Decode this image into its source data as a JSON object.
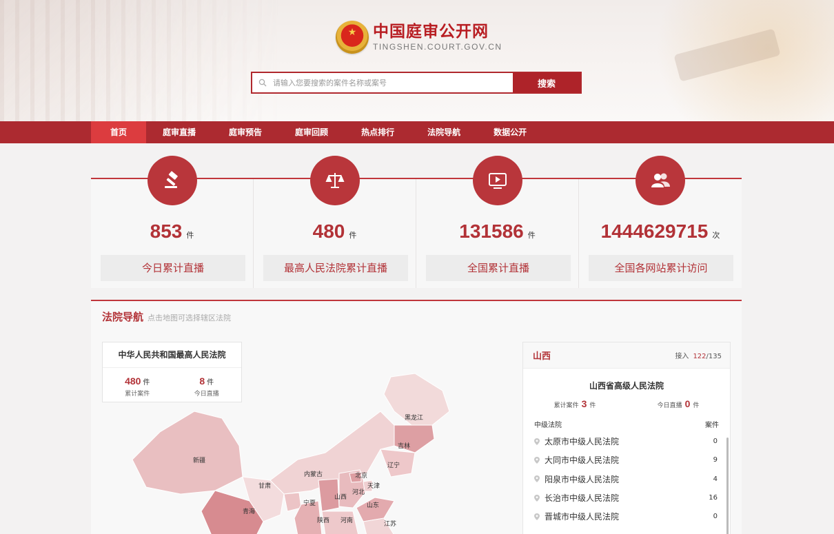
{
  "header": {
    "title": "中国庭审公开网",
    "subtitle": "TINGSHEN.COURT.GOV.CN",
    "search_placeholder": "请输入您要搜索的案件名称或案号",
    "search_button": "搜索"
  },
  "nav": {
    "items": [
      {
        "label": "首页"
      },
      {
        "label": "庭审直播"
      },
      {
        "label": "庭审预告"
      },
      {
        "label": "庭审回顾"
      },
      {
        "label": "热点排行"
      },
      {
        "label": "法院导航"
      },
      {
        "label": "数据公开"
      }
    ]
  },
  "stats": [
    {
      "icon": "gavel-icon",
      "value": "853",
      "unit": "件",
      "label": "今日累计直播"
    },
    {
      "icon": "scales-icon",
      "value": "480",
      "unit": "件",
      "label": "最高人民法院累计直播"
    },
    {
      "icon": "play-icon",
      "value": "131586",
      "unit": "件",
      "label": "全国累计直播"
    },
    {
      "icon": "users-icon",
      "value": "1444629715",
      "unit": "次",
      "label": "全国各网站累计访问"
    }
  ],
  "court_nav": {
    "title": "法院导航",
    "hint": "点击地图可选择辖区法院",
    "supreme": {
      "name": "中华人民共和国最高人民法院",
      "total_value": "480",
      "total_unit": "件",
      "total_label": "累计案件",
      "today_value": "8",
      "today_unit": "件",
      "today_label": "今日直播"
    },
    "map_labels": [
      "黑龙江",
      "吉林",
      "辽宁",
      "新疆",
      "内蒙古",
      "北京",
      "天津",
      "甘肃",
      "河北",
      "宁夏",
      "山西",
      "山东",
      "青海",
      "陕西",
      "河南",
      "江苏"
    ],
    "province": {
      "name": "山西",
      "connected_label": "接入",
      "connected": "122",
      "total": "/135",
      "court_name": "山西省高级人民法院",
      "total_cases_label": "累计案件",
      "total_cases": "3",
      "today_label": "今日直播",
      "today": "0",
      "unit": "件",
      "mid_header": "中级法院",
      "cases_header": "案件",
      "courts": [
        {
          "name": "太原市中级人民法院",
          "count": "0"
        },
        {
          "name": "大同市中级人民法院",
          "count": "9"
        },
        {
          "name": "阳泉市中级人民法院",
          "count": "4"
        },
        {
          "name": "长治市中级人民法院",
          "count": "16"
        },
        {
          "name": "晋城市中级人民法院",
          "count": "0"
        }
      ]
    }
  },
  "colors": {
    "primary": "#ac2a30",
    "active": "#dc3c3f",
    "accent": "#b23237"
  }
}
